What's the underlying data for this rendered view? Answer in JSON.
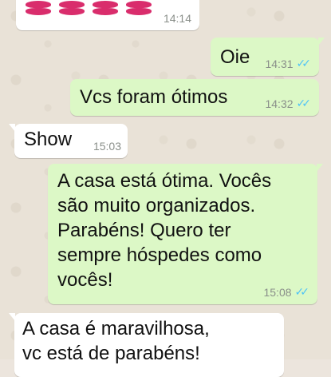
{
  "messages": [
    {
      "type": "incoming",
      "text": "",
      "time": "14:14",
      "content": "kiss-marks-emoji"
    },
    {
      "type": "outgoing",
      "text": "Oie",
      "time": "14:31",
      "status": "read"
    },
    {
      "type": "outgoing",
      "text": "Vcs foram ótimos",
      "time": "14:32",
      "status": "read"
    },
    {
      "type": "incoming",
      "text": "Show",
      "time": "15:03"
    },
    {
      "type": "outgoing",
      "text": "A casa está ótima. Vocês\nsão muito organizados.\nParabéns! Quero ter\nsempre hóspedes como\nvocês!",
      "time": "15:08",
      "status": "read"
    },
    {
      "type": "incoming",
      "text": "A casa é maravilhosa,\nvc está de parabéns!",
      "time": ""
    }
  ],
  "icons": {
    "read_ticks": "✓✓",
    "read_color": "#4fc3f7"
  },
  "colors": {
    "incoming_bubble": "#ffffff",
    "outgoing_bubble": "#dcf8c6",
    "wallpaper": "#e9e2d7"
  }
}
